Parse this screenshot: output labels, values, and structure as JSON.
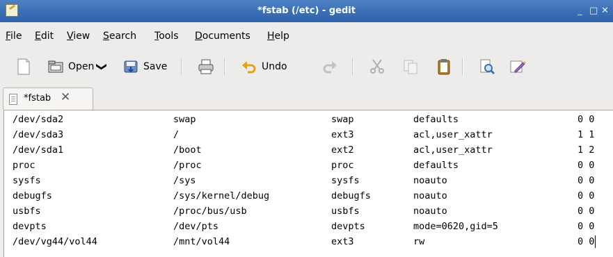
{
  "window": {
    "title": "*fstab (/etc) - gedit",
    "min_label": "_",
    "max_label": "□",
    "close_label": "✕"
  },
  "menubar": {
    "items": [
      {
        "label": "File",
        "mnemonic": "F"
      },
      {
        "label": "Edit",
        "mnemonic": "E"
      },
      {
        "label": "View",
        "mnemonic": "V"
      },
      {
        "label": "Search",
        "mnemonic": "S"
      },
      {
        "label": "Tools",
        "mnemonic": "T"
      },
      {
        "label": "Documents",
        "mnemonic": "D"
      },
      {
        "label": "Help",
        "mnemonic": "H"
      }
    ]
  },
  "toolbar": {
    "new_icon": "new-document-icon",
    "open_label": "Open",
    "open_dropdown": "❯",
    "save_label": "Save",
    "undo_label": "Undo"
  },
  "tab": {
    "label": "*fstab",
    "close": "✕"
  },
  "document": {
    "rows": [
      [
        "/dev/sda2",
        "swap",
        "swap",
        "defaults",
        "0 0"
      ],
      [
        "/dev/sda3",
        "/",
        "ext3",
        "acl,user_xattr",
        "1 1"
      ],
      [
        "/dev/sda1",
        "/boot",
        "ext2",
        "acl,user_xattr",
        "1 2"
      ],
      [
        "proc",
        "/proc",
        "proc",
        "defaults",
        "0 0"
      ],
      [
        "sysfs",
        "/sys",
        "sysfs",
        "noauto",
        "0 0"
      ],
      [
        "debugfs",
        "/sys/kernel/debug",
        "debugfs",
        "noauto",
        "0 0"
      ],
      [
        "usbfs",
        "/proc/bus/usb",
        "usbfs",
        "noauto",
        "0 0"
      ],
      [
        "devpts",
        "/dev/pts",
        "devpts",
        "mode=0620,gid=5",
        "0 0"
      ],
      [
        "/dev/vg44/vol44",
        "/mnt/vol44",
        "ext3",
        "rw",
        "0 0"
      ]
    ]
  }
}
